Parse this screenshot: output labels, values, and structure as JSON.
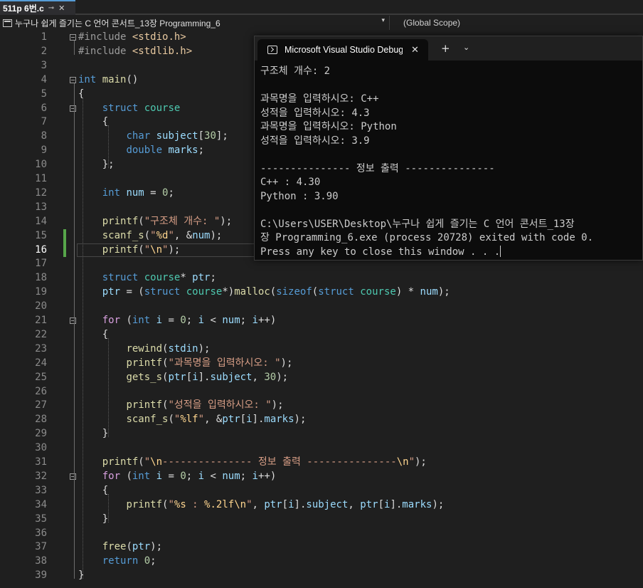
{
  "tab": {
    "filename": "511p 6번.c",
    "pin_icon": "pin-icon",
    "close_icon": "close-icon"
  },
  "navbar": {
    "project": "누구나 쉽게 즐기는 C 언어 콘서트_13장 Programming_6",
    "scope": "(Global Scope)",
    "dropdown_icon": "chevron-down-icon"
  },
  "editor": {
    "current_line": 16,
    "changed_lines": [
      15,
      16
    ],
    "line_numbers": [
      "1",
      "2",
      "3",
      "4",
      "5",
      "6",
      "7",
      "8",
      "9",
      "10",
      "11",
      "12",
      "13",
      "14",
      "15",
      "16",
      "17",
      "18",
      "19",
      "20",
      "21",
      "22",
      "23",
      "24",
      "25",
      "26",
      "27",
      "28",
      "29",
      "30",
      "31",
      "32",
      "33",
      "34",
      "35",
      "36",
      "37",
      "38",
      "39"
    ],
    "lines": [
      "#include <stdio.h>",
      "#include <stdlib.h>",
      "",
      "int main()",
      "{",
      "    struct course",
      "    {",
      "        char subject[30];",
      "        double marks;",
      "    };",
      "",
      "    int num = 0;",
      "",
      "    printf(\"구조체 개수: \");",
      "    scanf_s(\"%d\", &num);",
      "    printf(\"\\n\");",
      "",
      "    struct course* ptr;",
      "    ptr = (struct course*)malloc(sizeof(struct course) * num);",
      "",
      "    for (int i = 0; i < num; i++)",
      "    {",
      "        rewind(stdin);",
      "        printf(\"과목명을 입력하시오: \");",
      "        gets_s(ptr[i].subject, 30);",
      "",
      "        printf(\"성적을 입력하시오: \");",
      "        scanf_s(\"%lf\", &ptr[i].marks);",
      "    }",
      "",
      "    printf(\"\\n--------------- 정보 출력 ---------------\\n\");",
      "    for (int i = 0; i < num; i++)",
      "    {",
      "        printf(\"%s : %.2lf\\n\", ptr[i].subject, ptr[i].marks);",
      "    }",
      "",
      "    free(ptr);",
      "    return 0;",
      "}"
    ]
  },
  "console": {
    "title": "Microsoft Visual Studio Debug Console",
    "icon": "terminal-icon",
    "new_tab_label": "+",
    "lines": [
      "구조체 개수: 2",
      "",
      "과목명을 입력하시오: C++",
      "성적을 입력하시오: 4.3",
      "과목명을 입력하시오: Python",
      "성적을 입력하시오: 3.9",
      "",
      "--------------- 정보 출력 ---------------",
      "C++ : 4.30",
      "Python : 3.90",
      "",
      "C:\\Users\\USER\\Desktop\\누구나 쉽게 즐기는 C 언어 콘서트_13장",
      "장 Programming_6.exe (process 20728) exited with code 0.",
      "Press any key to close this window . . ."
    ]
  }
}
